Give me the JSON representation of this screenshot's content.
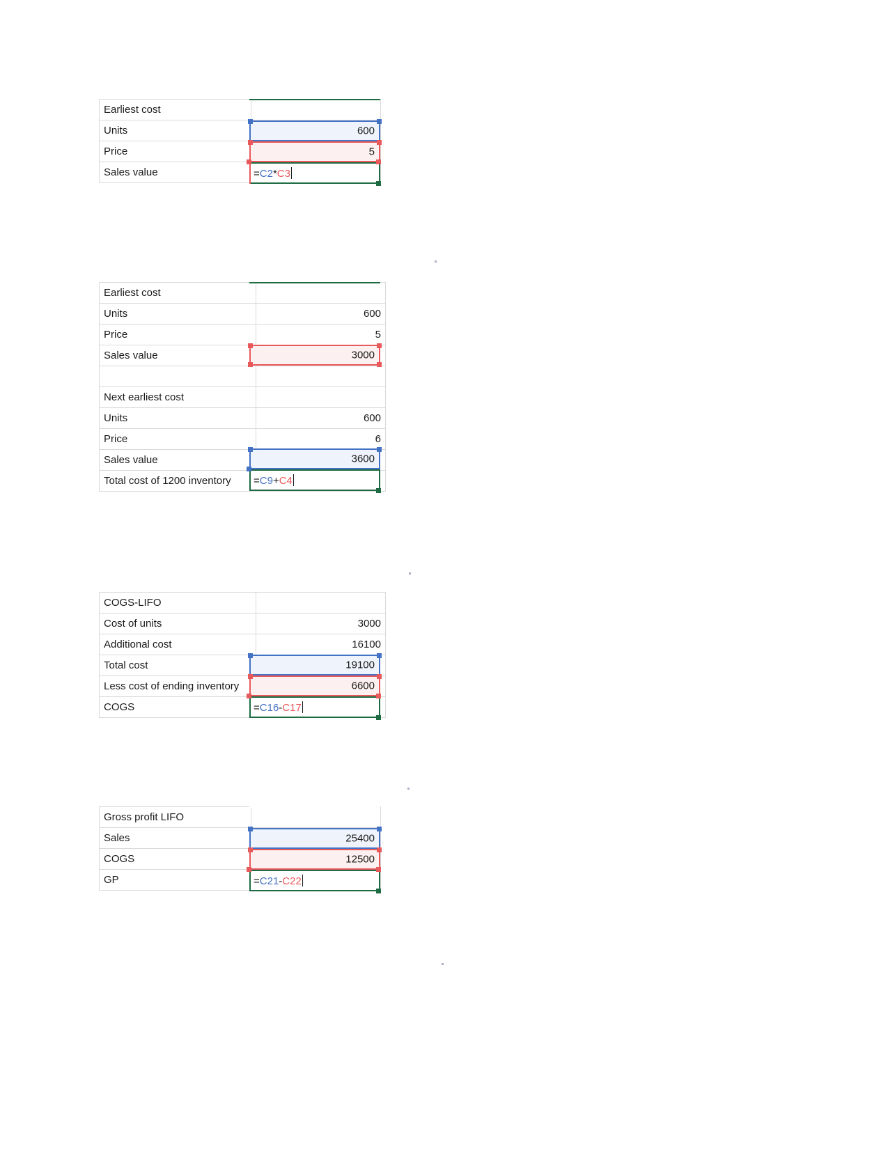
{
  "document": {
    "kind": "spreadsheet-screenshots",
    "app": "spreadsheet",
    "topic": "LIFO inventory cost and gross profit worksheets"
  },
  "colors": {
    "trace_blue": "#4472c4",
    "trace_red": "#e8595c",
    "active_green": "#1e6b43",
    "blue_fill": "#eff3fb",
    "red_fill": "#fdf0f0",
    "grid": "#d9d9d9",
    "text": "#1a1a1a"
  },
  "blocks": [
    {
      "id": "block-1",
      "title": "Earliest cost",
      "rows": [
        {
          "label": "Earliest cost",
          "value": ""
        },
        {
          "label": "Units",
          "value": "600"
        },
        {
          "label": "Price",
          "value": "5"
        },
        {
          "label": "Sales value",
          "value": ""
        }
      ],
      "formula": {
        "text": "=C2*C3",
        "ref1": "C2",
        "operator": "*",
        "ref2": "C3"
      },
      "precedents": [
        {
          "ref": "C2",
          "color": "blue",
          "value": "600"
        },
        {
          "ref": "C3",
          "color": "red",
          "value": "5"
        }
      ]
    },
    {
      "id": "block-2",
      "title": "Earliest cost / Next earliest cost",
      "rows": [
        {
          "label": "Earliest cost",
          "value": ""
        },
        {
          "label": "Units",
          "value": "600"
        },
        {
          "label": "Price",
          "value": "5"
        },
        {
          "label": "Sales value",
          "value": "3000"
        },
        {
          "label": "",
          "value": ""
        },
        {
          "label": "Next earliest cost",
          "value": ""
        },
        {
          "label": "Units",
          "value": "600"
        },
        {
          "label": "Price",
          "value": "6"
        },
        {
          "label": "Sales value",
          "value": "3600"
        },
        {
          "label": "Total cost of 1200 inventory",
          "value": ""
        }
      ],
      "formula": {
        "text": "=C9+C4",
        "ref1": "C9",
        "operator": "+",
        "ref2": "C4"
      },
      "precedents": [
        {
          "ref": "C9",
          "color": "blue",
          "value": "3600"
        },
        {
          "ref": "C4",
          "color": "red",
          "value": "3000"
        }
      ]
    },
    {
      "id": "block-3",
      "title": "COGS-LIFO",
      "rows": [
        {
          "label": "COGS-LIFO",
          "value": ""
        },
        {
          "label": "Cost of units",
          "value": "3000"
        },
        {
          "label": "Additional cost",
          "value": "16100"
        },
        {
          "label": "Total cost",
          "value": "19100"
        },
        {
          "label": "Less cost of ending inventory",
          "value": "6600"
        },
        {
          "label": "COGS",
          "value": ""
        }
      ],
      "formula": {
        "text": "=C16-C17",
        "ref1": "C16",
        "operator": "-",
        "ref2": "C17"
      },
      "precedents": [
        {
          "ref": "C16",
          "color": "blue",
          "value": "19100"
        },
        {
          "ref": "C17",
          "color": "red",
          "value": "6600"
        }
      ]
    },
    {
      "id": "block-4",
      "title": "Gross profit LIFO",
      "rows": [
        {
          "label": "Gross profit LIFO",
          "value": ""
        },
        {
          "label": "Sales",
          "value": "25400"
        },
        {
          "label": "COGS",
          "value": "12500"
        },
        {
          "label": "GP",
          "value": ""
        }
      ],
      "formula": {
        "text": "=C21-C22",
        "ref1": "C21",
        "operator": "-",
        "ref2": "C22"
      },
      "precedents": [
        {
          "ref": "C21",
          "color": "blue",
          "value": "25400"
        },
        {
          "ref": "C22",
          "color": "red",
          "value": "12500"
        }
      ]
    }
  ]
}
